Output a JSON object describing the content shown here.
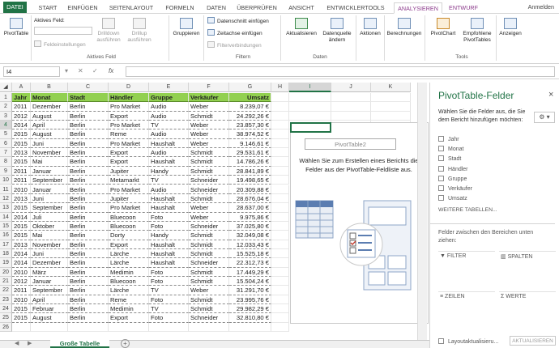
{
  "tabs": {
    "file": "DATEI",
    "items": [
      "START",
      "EINFÜGEN",
      "SEITENLAYOUT",
      "FORMELN",
      "DATEN",
      "ÜBERPRÜFEN",
      "ANSICHT",
      "ENTWICKLERTOOLS"
    ],
    "active": "ANALYSIEREN",
    "design": "ENTWURF",
    "user": "Anmelden"
  },
  "ribbon": {
    "pivottable": "PivotTable",
    "active_field_label": "Aktives Feld:",
    "field_settings": "Feldeinstellungen",
    "drilldown": "Drilldown ausführen",
    "drillup": "Drillup ausführen",
    "group_active_field": "Aktives Feld",
    "gruppieren": "Gruppieren",
    "datenschnitt": "Datenschnitt einfügen",
    "zeitachse": "Zeitachse einfügen",
    "filterverbindungen": "Filterverbindungen",
    "group_filter": "Filtern",
    "aktualisieren": "Aktualisieren",
    "datenquelle": "Datenquelle ändern",
    "group_daten": "Daten",
    "aktionen": "Aktionen",
    "berechnungen": "Berechnungen",
    "pivotchart": "PivotChart",
    "empfohlene": "Empfohlene PivotTables",
    "group_tools": "Tools",
    "anzeigen": "Anzeigen"
  },
  "formula_bar": {
    "name_box": "I4",
    "fx": "fx"
  },
  "columns": [
    "A",
    "B",
    "C",
    "D",
    "E",
    "F",
    "G",
    "H",
    "I",
    "J",
    "K"
  ],
  "selected_column": "I",
  "table": {
    "headers": [
      "Jahr",
      "Monat",
      "Stadt",
      "Händler",
      "Gruppe",
      "Verkäufer",
      "Umsatz"
    ],
    "rows": [
      [
        "2011",
        "Dezember",
        "Berlin",
        "Pro Market",
        "Audio",
        "Weber",
        "8.239,07 €"
      ],
      [
        "2012",
        "August",
        "Berlin",
        "Export",
        "Audio",
        "Schmidt",
        "24.292,26 €"
      ],
      [
        "2014",
        "April",
        "Berlin",
        "Pro Market",
        "TV",
        "Weber",
        "23.857,30 €"
      ],
      [
        "2015",
        "August",
        "Berlin",
        "Reme",
        "Audio",
        "Weber",
        "38.974,52 €"
      ],
      [
        "2015",
        "Juni",
        "Berlin",
        "Pro Market",
        "Haushalt",
        "Weber",
        "9.146,61 €"
      ],
      [
        "2013",
        "November",
        "Berlin",
        "Export",
        "Audio",
        "Schmidt",
        "29.531,61 €"
      ],
      [
        "2015",
        "Mai",
        "Berlin",
        "Export",
        "Haushalt",
        "Schmidt",
        "14.786,26 €"
      ],
      [
        "2011",
        "Januar",
        "Berlin",
        "Jupiter",
        "Handy",
        "Schmidt",
        "28.841,89 €"
      ],
      [
        "2011",
        "September",
        "Berlin",
        "Metamarkt",
        "TV",
        "Schneider",
        "19.498,65 €"
      ],
      [
        "2010",
        "Januar",
        "Berlin",
        "Pro Market",
        "Audio",
        "Schneider",
        "20.309,88 €"
      ],
      [
        "2013",
        "Juni",
        "Berlin",
        "Jupiter",
        "Haushalt",
        "Schmidt",
        "28.676,04 €"
      ],
      [
        "2015",
        "September",
        "Berlin",
        "Pro Market",
        "Haushalt",
        "Weber",
        "28.637,00 €"
      ],
      [
        "2014",
        "Juli",
        "Berlin",
        "Bluecoon",
        "Foto",
        "Weber",
        "9.975,86 €"
      ],
      [
        "2015",
        "Oktober",
        "Berlin",
        "Bluecoon",
        "Foto",
        "Schneider",
        "37.025,80 €"
      ],
      [
        "2015",
        "Mai",
        "Berlin",
        "Dorty",
        "Handy",
        "Schmidt",
        "32.049,08 €"
      ],
      [
        "2013",
        "November",
        "Berlin",
        "Export",
        "Haushalt",
        "Schmidt",
        "12.033,43 €"
      ],
      [
        "2014",
        "Juni",
        "Berlin",
        "Lärche",
        "Haushalt",
        "Schmidt",
        "15.525,18 €"
      ],
      [
        "2014",
        "Dezember",
        "Berlin",
        "Lärche",
        "Haushalt",
        "Schneider",
        "22.312,73 €"
      ],
      [
        "2010",
        "März",
        "Berlin",
        "Medimin",
        "Foto",
        "Schmidt",
        "17.449,29 €"
      ],
      [
        "2012",
        "Januar",
        "Berlin",
        "Bluecoon",
        "Foto",
        "Schmidt",
        "15.504,24 €"
      ],
      [
        "2011",
        "September",
        "Berlin",
        "Lärche",
        "TV",
        "Weber",
        "31.291,70 €"
      ],
      [
        "2010",
        "April",
        "Berlin",
        "Reme",
        "Foto",
        "Schmidt",
        "23.995,76 €"
      ],
      [
        "2015",
        "Februar",
        "Berlin",
        "Medimin",
        "TV",
        "Schmidt",
        "29.982,29 €"
      ],
      [
        "2015",
        "August",
        "Berlin",
        "Export",
        "Foto",
        "Schneider",
        "32.810,80 €"
      ]
    ]
  },
  "row_numbers": [
    "1",
    "2",
    "3",
    "4",
    "5",
    "6",
    "7",
    "8",
    "9",
    "10",
    "11",
    "12",
    "13",
    "14",
    "15",
    "16",
    "17",
    "18",
    "19",
    "20",
    "21",
    "22",
    "23",
    "24",
    "25",
    "26"
  ],
  "pivot_placeholder": {
    "name": "PivotTable2",
    "text": "Wählen Sie zum Erstellen eines Berichts die Felder aus der PivotTable-Feldliste aus."
  },
  "panel": {
    "title": "PivotTable-Felder",
    "close": "×",
    "description": "Wählen Sie die Felder aus, die Sie dem Bericht hinzufügen möchten:",
    "fields": [
      "Jahr",
      "Monat",
      "Stadt",
      "Händler",
      "Gruppe",
      "Verkäufer",
      "Umsatz"
    ],
    "more_tables": "WEITERE TABELLEN...",
    "drag_text": "Felder zwischen den Bereichen unten ziehen:",
    "areas": {
      "filter": "FILTER",
      "columns": "SPALTEN",
      "rows": "ZEILEN",
      "values": "WERTE"
    },
    "defer_update": "Layoutaktualisieru...",
    "update_button": "AKTUALISIEREN"
  },
  "sheet": {
    "tab": "Große Tabelle",
    "add": "+"
  },
  "colors": {
    "accent": "#217346",
    "header_fill": "#92d050",
    "analyze_tab": "#8b3a8b"
  }
}
